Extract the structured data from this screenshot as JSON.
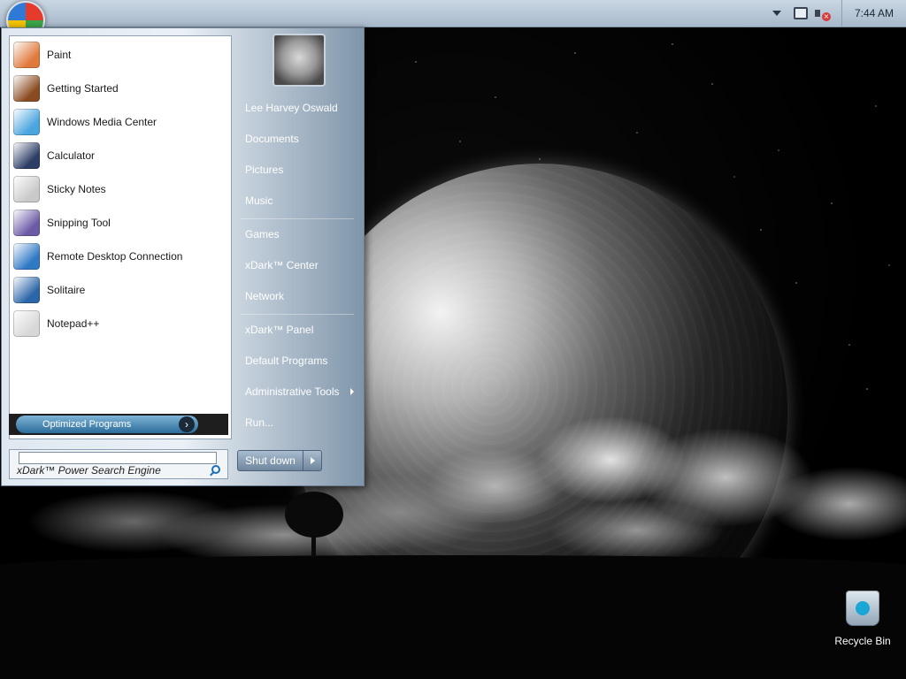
{
  "taskbar": {
    "clock": "7:44 AM"
  },
  "start_menu": {
    "programs": [
      {
        "label": "Paint",
        "icon": "paint-icon",
        "color": "#e07a3c"
      },
      {
        "label": "Getting Started",
        "icon": "getting-started-icon",
        "color": "#8a4b20"
      },
      {
        "label": "Windows Media Center",
        "icon": "media-center-icon",
        "color": "#4aa6df"
      },
      {
        "label": "Calculator",
        "icon": "calculator-icon",
        "color": "#2c3d66"
      },
      {
        "label": "Sticky Notes",
        "icon": "sticky-notes-icon",
        "color": "#c9c9c9"
      },
      {
        "label": "Snipping Tool",
        "icon": "snipping-tool-icon",
        "color": "#6c5aa6"
      },
      {
        "label": "Remote Desktop Connection",
        "icon": "remote-desktop-icon",
        "color": "#2f79c5"
      },
      {
        "label": "Solitaire",
        "icon": "solitaire-icon",
        "color": "#2b66a8"
      },
      {
        "label": "Notepad++",
        "icon": "notepad-plus-plus-icon",
        "color": "#d8d8d8"
      }
    ],
    "optimized_programs": "Optimized Programs",
    "search_placeholder": "xDark™ Power Search Engine",
    "user_name": "Lee Harvey Oswald",
    "right_items": [
      {
        "label": "Documents"
      },
      {
        "label": "Pictures"
      },
      {
        "label": "Music"
      },
      {
        "label": "Games"
      },
      {
        "label": "xDark™ Center"
      },
      {
        "label": "Network"
      },
      {
        "label": "xDark™ Panel"
      },
      {
        "label": "Default Programs"
      },
      {
        "label": "Administrative Tools"
      },
      {
        "label": "Run..."
      }
    ],
    "shutdown_label": "Shut down"
  },
  "desktop": {
    "recycle_bin_label": "Recycle Bin"
  }
}
